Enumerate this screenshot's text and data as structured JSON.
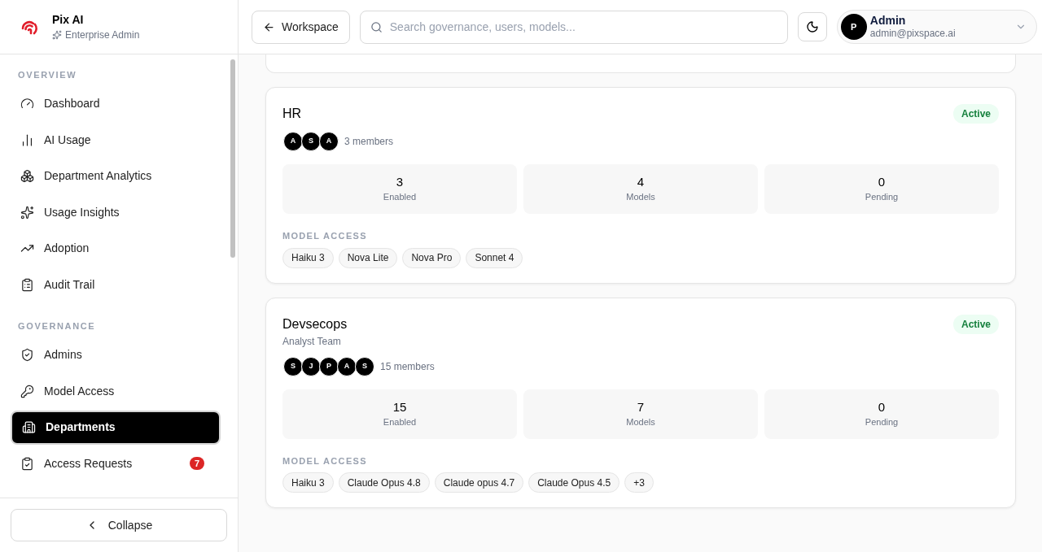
{
  "brand": {
    "name": "Pix AI",
    "subtitle": "Enterprise Admin"
  },
  "sidebar": {
    "sections": [
      {
        "heading": "OVERVIEW",
        "items": [
          {
            "label": "Dashboard",
            "kind": "gauge",
            "selected": false
          },
          {
            "label": "AI Usage",
            "kind": "chart",
            "selected": false
          },
          {
            "label": "Department Analytics",
            "kind": "cluster",
            "selected": false
          },
          {
            "label": "Usage Insights",
            "kind": "sparkles",
            "selected": false
          },
          {
            "label": "Adoption",
            "kind": "trend",
            "selected": false
          },
          {
            "label": "Audit Trail",
            "kind": "clipboard",
            "selected": false
          }
        ]
      },
      {
        "heading": "GOVERNANCE",
        "items": [
          {
            "label": "Admins",
            "kind": "shield",
            "selected": false
          },
          {
            "label": "Model Access",
            "kind": "key",
            "selected": false
          },
          {
            "label": "Departments",
            "kind": "building",
            "selected": true
          },
          {
            "label": "Access Requests",
            "kind": "approval",
            "selected": false,
            "badge": "7"
          }
        ]
      }
    ],
    "collapse": "Collapse"
  },
  "header": {
    "back": "Workspace",
    "search": {
      "placeholder": "Search governance, users, models..."
    },
    "user": {
      "initial": "P",
      "name": "Admin",
      "email": "admin@pixspace.ai"
    }
  },
  "departments": [
    {
      "name": "HR",
      "status": "Active",
      "members": [
        "A",
        "S",
        "A"
      ],
      "member_count": "3 members",
      "stats": [
        {
          "value": "3",
          "label": "Enabled"
        },
        {
          "value": "4",
          "label": "Models"
        },
        {
          "value": "0",
          "label": "Pending"
        }
      ],
      "access_heading": "MODEL ACCESS",
      "models": [
        "Haiku 3",
        "Nova Lite",
        "Nova Pro",
        "Sonnet 4"
      ]
    },
    {
      "name": "Devsecops",
      "team": "Analyst Team",
      "status": "Active",
      "members": [
        "S",
        "J",
        "P",
        "A",
        "S"
      ],
      "member_count": "15 members",
      "stats": [
        {
          "value": "15",
          "label": "Enabled"
        },
        {
          "value": "7",
          "label": "Models"
        },
        {
          "value": "0",
          "label": "Pending"
        }
      ],
      "access_heading": "MODEL ACCESS",
      "models": [
        "Haiku 3",
        "Claude Opus 4.8",
        "Claude opus 4.7",
        "Claude Opus 4.5",
        "+3"
      ]
    }
  ]
}
